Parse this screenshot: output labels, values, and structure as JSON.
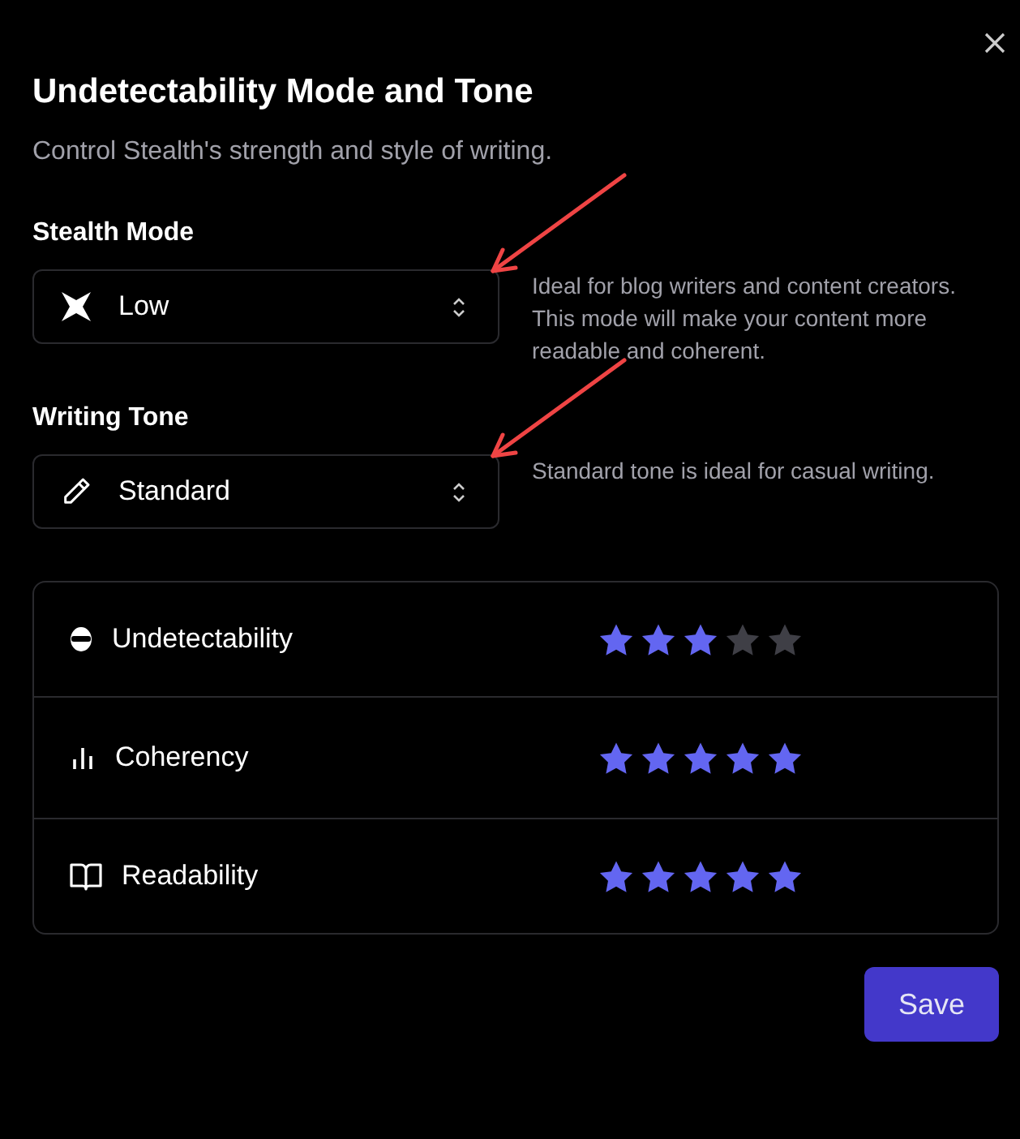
{
  "dialog": {
    "title": "Undetectability Mode and Tone",
    "subtitle": "Control Stealth's strength and style of writing."
  },
  "settings": [
    {
      "label": "Stealth Mode",
      "value": "Low",
      "description": "Ideal for blog writers and content creators. This mode will make your content more readable and coherent."
    },
    {
      "label": "Writing Tone",
      "value": "Standard",
      "description": "Standard tone is ideal for casual writing."
    }
  ],
  "ratings": [
    {
      "name": "Undetectability",
      "stars": 3
    },
    {
      "name": "Coherency",
      "stars": 5
    },
    {
      "name": "Readability",
      "stars": 5
    }
  ],
  "buttons": [
    "Save"
  ]
}
